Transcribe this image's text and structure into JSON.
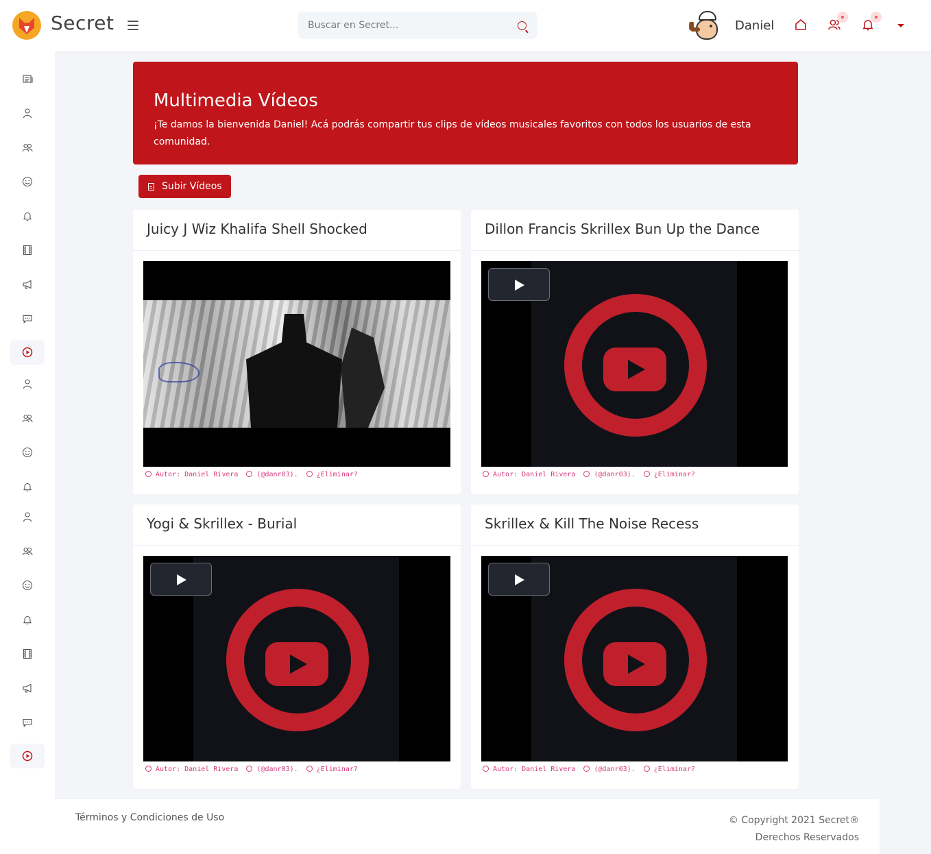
{
  "header": {
    "brand": "Secret",
    "search_placeholder": "Buscar en Secret...",
    "username": "Daniel"
  },
  "sidebar": {
    "items": [
      {
        "icon": "newspaper-icon"
      },
      {
        "icon": "user-icon"
      },
      {
        "icon": "users-icon"
      },
      {
        "icon": "smile-icon"
      },
      {
        "icon": "bell-icon"
      },
      {
        "icon": "film-icon"
      },
      {
        "icon": "megaphone-icon"
      },
      {
        "icon": "chat-icon"
      },
      {
        "icon": "play-circle-icon",
        "active": true
      },
      {
        "icon": "user-icon"
      },
      {
        "icon": "users-icon"
      },
      {
        "icon": "smile-icon"
      },
      {
        "icon": "bell-icon"
      },
      {
        "icon": "user-icon"
      },
      {
        "icon": "users-icon"
      },
      {
        "icon": "smile-icon"
      },
      {
        "icon": "bell-icon"
      },
      {
        "icon": "film-icon"
      },
      {
        "icon": "megaphone-icon"
      },
      {
        "icon": "chat-icon"
      },
      {
        "icon": "play-circle-icon",
        "active": true
      }
    ]
  },
  "banner": {
    "title": "Multimedia Vídeos",
    "text": "¡Te damos la bienvenida Daniel! Acá podrás compartir tus clips de vídeos musicales favoritos con todos los usuarios de esta comunidad."
  },
  "upload_label": "Subir Vídeos",
  "videos": [
    {
      "title": "Juicy J Wiz Khalifa Shell Shocked",
      "author": "Autor: Daniel Rivera",
      "handle": "(@danr03).",
      "delete": "¿Eliminar?"
    },
    {
      "title": "Dillon Francis Skrillex Bun Up the Dance",
      "author": "Autor: Daniel Rivera",
      "handle": "(@danr03).",
      "delete": "¿Eliminar?"
    },
    {
      "title": "Yogi & Skrillex - Burial",
      "author": "Autor: Daniel Rivera",
      "handle": "(@danr03).",
      "delete": "¿Eliminar?"
    },
    {
      "title": "Skrillex & Kill The Noise Recess",
      "author": "Autor: Daniel Rivera",
      "handle": "(@danr03).",
      "delete": "¿Eliminar?"
    }
  ],
  "footer": {
    "terms": "Términos y Condiciones de Uso",
    "copyright": "© Copyright 2021 Secret®",
    "rights": "Derechos Reservados"
  },
  "colors": {
    "accent": "#c0161b",
    "meta_pink": "#d63a7b",
    "page_bg": "#f4f5f8"
  }
}
